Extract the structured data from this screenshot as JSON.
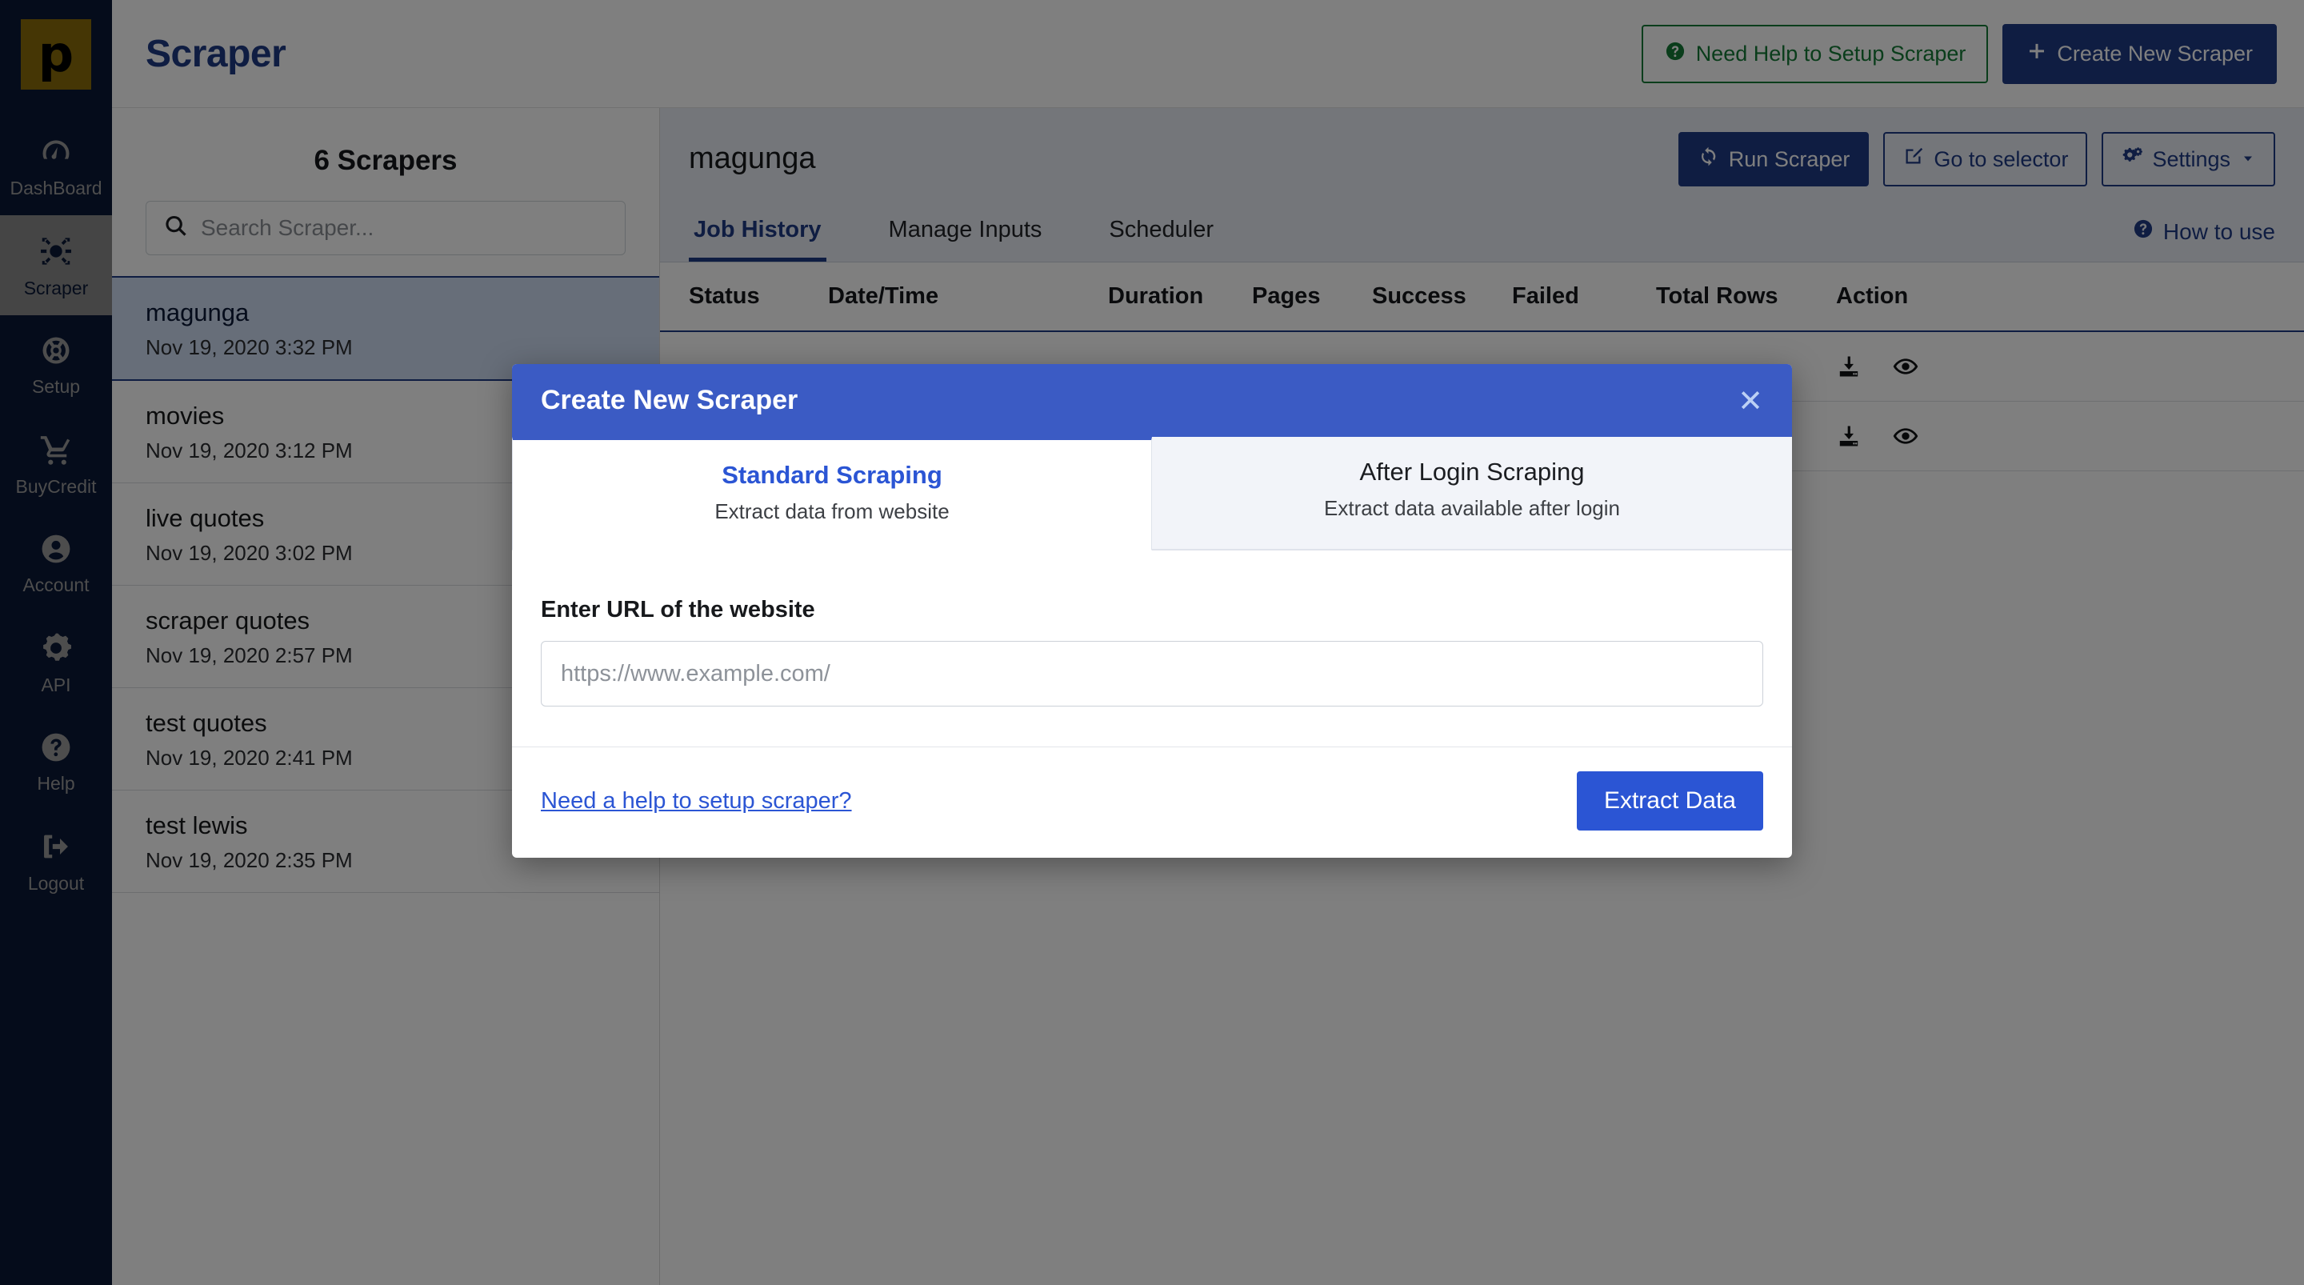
{
  "app": {
    "logo_letter": "p",
    "title": "Scraper"
  },
  "rail": {
    "items": [
      {
        "label": "DashBoard",
        "icon": "dashboard-icon",
        "active": false
      },
      {
        "label": "Scraper",
        "icon": "spider-icon",
        "active": true
      },
      {
        "label": "Setup",
        "icon": "lifebuoy-icon",
        "active": false
      },
      {
        "label": "BuyCredit",
        "icon": "shopping-cart-icon",
        "active": false
      },
      {
        "label": "Account",
        "icon": "user-circle-icon",
        "active": false
      },
      {
        "label": "API",
        "icon": "api-gear-icon",
        "active": false
      },
      {
        "label": "Help",
        "icon": "question-circle-icon",
        "active": false
      },
      {
        "label": "Logout",
        "icon": "logout-icon",
        "active": false
      }
    ]
  },
  "topbar": {
    "help_button": "Need Help to Setup Scraper",
    "help_icon": "question-circle-icon",
    "create_button": "Create New Scraper",
    "create_icon": "plus-icon",
    "help_color": "#157a36",
    "create_color": "#1f3a85"
  },
  "list_panel": {
    "heading": "6 Scrapers",
    "search": {
      "placeholder": "Search Scraper...",
      "value": "",
      "icon": "search-icon"
    },
    "items": [
      {
        "name": "magunga",
        "date": "Nov 19, 2020 3:32 PM",
        "selected": true
      },
      {
        "name": "movies",
        "date": "Nov 19, 2020 3:12 PM",
        "selected": false
      },
      {
        "name": "live quotes",
        "date": "Nov 19, 2020 3:02 PM",
        "selected": false
      },
      {
        "name": "scraper quotes",
        "date": "Nov 19, 2020 2:57 PM",
        "selected": false
      },
      {
        "name": "test quotes",
        "date": "Nov 19, 2020 2:41 PM",
        "selected": false
      },
      {
        "name": "test lewis",
        "date": "Nov 19, 2020 2:35 PM",
        "selected": false
      }
    ]
  },
  "main_panel": {
    "heading": "magunga",
    "actions": [
      {
        "label": "Run Scraper",
        "icon": "refresh-icon",
        "style": "solid"
      },
      {
        "label": "Go to selector",
        "icon": "edit-box-icon",
        "style": "outline"
      },
      {
        "label": "Settings",
        "icon": "gears-icon",
        "style": "outline",
        "caret": true
      }
    ],
    "tabs": [
      {
        "label": "Job History",
        "active": true
      },
      {
        "label": "Manage Inputs",
        "active": false
      },
      {
        "label": "Scheduler",
        "active": false
      }
    ],
    "how_to_use": "How to use",
    "how_to_use_icon": "question-circle-icon",
    "table": {
      "columns": [
        "Status",
        "Date/Time",
        "Duration",
        "Pages",
        "Success",
        "Failed",
        "Total Rows",
        "Action"
      ],
      "rows": [
        {
          "status": "",
          "datetime": "",
          "duration": "",
          "pages": "",
          "success": "",
          "failed": "",
          "total_rows": "",
          "actions": [
            "download-icon",
            "eye-icon"
          ]
        },
        {
          "status": "",
          "datetime": "",
          "duration": "",
          "pages": "",
          "success": "",
          "failed": "",
          "total_rows": "",
          "actions": [
            "download-icon",
            "eye-icon"
          ]
        }
      ]
    }
  },
  "modal": {
    "title": "Create New Scraper",
    "close_icon": "close-icon",
    "header_color": "#3b5bc4",
    "tabs": [
      {
        "title": "Standard Scraping",
        "subtitle": "Extract data from website",
        "active": true
      },
      {
        "title": "After Login Scraping",
        "subtitle": "Extract data available after login",
        "active": false
      }
    ],
    "field_label": "Enter URL of the website",
    "url_input": {
      "placeholder": "https://www.example.com/",
      "value": ""
    },
    "help_link": "Need a help to setup scraper?",
    "submit_button": "Extract Data",
    "submit_color": "#2b55d4"
  }
}
